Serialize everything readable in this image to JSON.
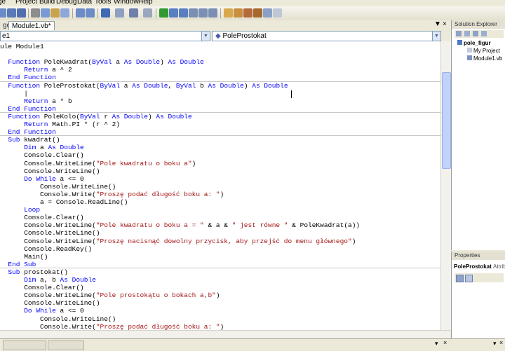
{
  "menu": {
    "items": [
      "ge",
      "Project",
      "Build",
      "Debug",
      "Data",
      "Tools",
      "Window",
      "Help"
    ]
  },
  "toolbar": {
    "icons": [
      "save-icon",
      "save-all-icon",
      "cut-icon",
      "copy-icon",
      "paste-icon",
      "find-icon",
      "comment-icon",
      "uncomment-icon",
      "undo-icon",
      "redo-icon",
      "navigate-icon",
      "start-debug-icon",
      "pause-icon",
      "stop-icon",
      "step-into-icon",
      "step-over-icon",
      "step-out-icon",
      "breakpoint-icon",
      "solution-explorer-icon",
      "properties-icon",
      "object-browser-icon",
      "toolbox-icon",
      "options-icon"
    ]
  },
  "tabs": {
    "inactive_label": "ge",
    "active_label": "Module1.vb*",
    "close_glyph": "×",
    "dropdown_glyph": "▼"
  },
  "combos": {
    "left_value": "e1",
    "right_value": "PoleProstokat"
  },
  "code": {
    "lines": [
      "ule Module1",
      "",
      "  Function PoleKwadrat(ByVal a As Double) As Double",
      "      Return a ^ 2",
      "  End Function",
      "  Function PoleProstokat(ByVal a As Double, ByVal b As Double) As Double",
      "      |",
      "      Return a * b",
      "  End Function",
      "  Function PoleKolo(ByVal r As Double) As Double",
      "      Return Math.PI * (r ^ 2)",
      "  End Function",
      "  Sub kwadrat()",
      "      Dim a As Double",
      "      Console.Clear()",
      "      Console.WriteLine(\"Pole kwadratu o boku a\")",
      "      Console.WriteLine()",
      "      Do While a <= 0",
      "          Console.WriteLine()",
      "          Console.Write(\"Proszę podać długość boku a: \")",
      "          a = Console.ReadLine()",
      "      Loop",
      "      Console.Clear()",
      "      Console.WriteLine(\"Pole kwadratu o boku a = \" & a & \" jest równe \" & PoleKwadrat(a))",
      "      Console.WriteLine()",
      "      Console.WriteLine(\"Proszę nacisnąć dowolny przycisk, aby przejść do menu głównego\")",
      "      Console.ReadKey()",
      "      Main()",
      "  End Sub",
      "  Sub prostokat()",
      "      Dim a, b As Double",
      "      Console.Clear()",
      "      Console.WriteLine(\"Pole prostokątu o bokach a,b\")",
      "      Console.WriteLine()",
      "      Do While a <= 0",
      "          Console.WriteLine()",
      "          Console.Write(\"Proszę podać długość boku a: \")"
    ]
  },
  "solution_explorer": {
    "title": "Solution Explorer",
    "project": "pole_figur",
    "my_project": "My Project",
    "module": "Module1.vb"
  },
  "properties": {
    "title": "Properties",
    "object": "PoleProstokat",
    "suffix": "Attrib"
  },
  "colors": {
    "keyword": "#0000ff",
    "string": "#a31515",
    "text": "#000000",
    "tab_active": "#ffffff"
  }
}
